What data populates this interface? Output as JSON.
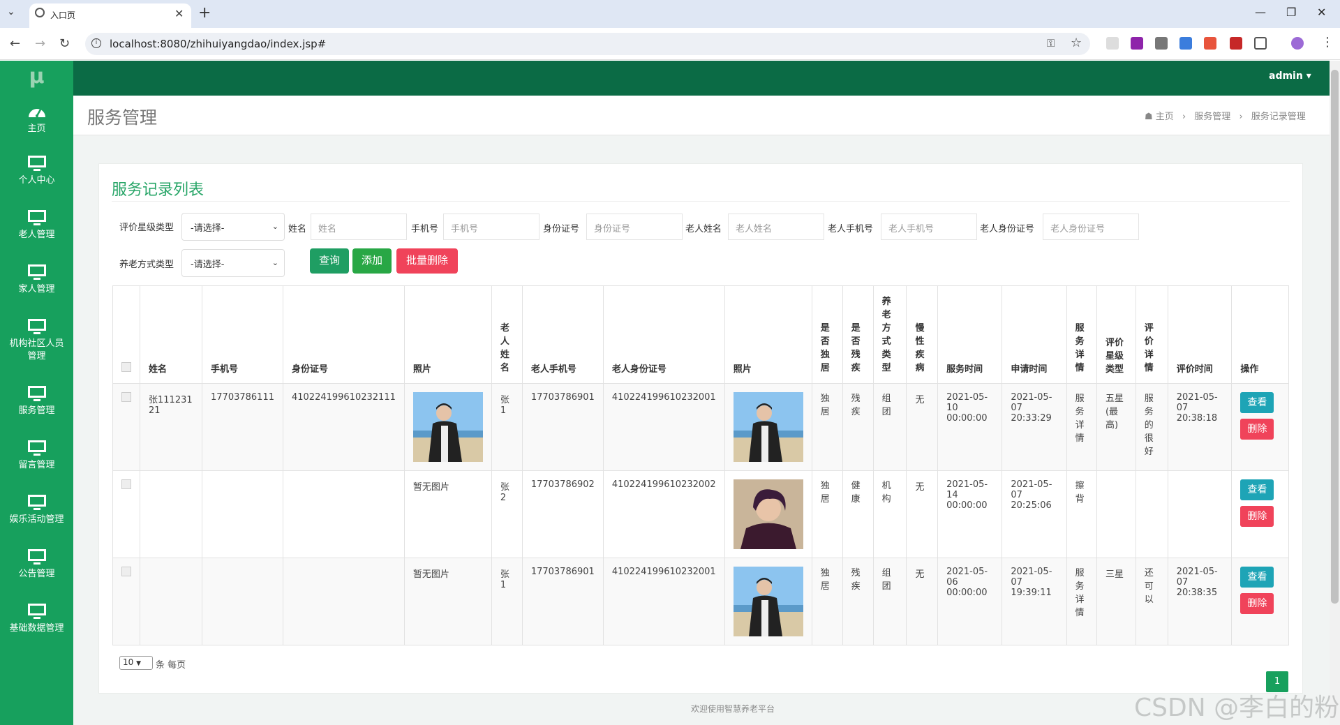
{
  "browser": {
    "tab_title": "入口页",
    "url": "localhost:8080/zhihuiyangdao/index.jsp#"
  },
  "sidebar": {
    "logo": "μ",
    "items": [
      {
        "label": "主页",
        "icon": "dashboard-icon"
      },
      {
        "label": "个人中心",
        "icon": "monitor-icon"
      },
      {
        "label": "老人管理",
        "icon": "monitor-icon"
      },
      {
        "label": "家人管理",
        "icon": "monitor-icon"
      },
      {
        "label": "机构社区人员管理",
        "icon": "monitor-icon"
      },
      {
        "label": "服务管理",
        "icon": "monitor-icon"
      },
      {
        "label": "留言管理",
        "icon": "monitor-icon"
      },
      {
        "label": "娱乐活动管理",
        "icon": "monitor-icon"
      },
      {
        "label": "公告管理",
        "icon": "monitor-icon"
      },
      {
        "label": "基础数据管理",
        "icon": "monitor-icon"
      }
    ]
  },
  "header": {
    "user": "admin ▾"
  },
  "page": {
    "title": "服务管理",
    "breadcrumb": [
      "主页",
      "服务管理",
      "服务记录管理"
    ],
    "card_title": "服务记录列表"
  },
  "search": {
    "rating_type_label": "评价星级类型",
    "rating_type_value": "-请选择-",
    "name_label": "姓名",
    "name_placeholder": "姓名",
    "phone_label": "手机号",
    "phone_placeholder": "手机号",
    "id_label": "身份证号",
    "id_placeholder": "身份证号",
    "elder_name_label": "老人姓名",
    "elder_name_placeholder": "老人姓名",
    "elder_phone_label": "老人手机号",
    "elder_phone_placeholder": "老人手机号",
    "elder_id_label": "老人身份证号",
    "elder_id_placeholder": "老人身份证号",
    "care_type_label": "养老方式类型",
    "care_type_value": "-请选择-",
    "query_btn": "查询",
    "add_btn": "添加",
    "batch_delete_btn": "批量删除"
  },
  "table": {
    "headers": [
      "姓名",
      "手机号",
      "身份证号",
      "照片",
      "老人姓名",
      "老人手机号",
      "老人身份证号",
      "照片",
      "是否独居",
      "是否残疾",
      "养老方式类型",
      "慢性疾病",
      "服务时间",
      "申请时间",
      "服务详情",
      "评价星级类型",
      "评价详情",
      "评价时间",
      "操作"
    ],
    "rows": [
      {
        "name": "张11123121",
        "phone": "17703786111",
        "id": "410224199610232111",
        "photo": "",
        "elder_name": "张1",
        "elder_phone": "17703786901",
        "elder_id": "410224199610232001",
        "alone": "独居",
        "disabled": "残疾",
        "care": "组团",
        "chronic": "无",
        "service_time": "2021-05-10 00:00:00",
        "apply_time": "2021-05-07 20:33:29",
        "detail": "服务详情",
        "rating": "五星(最高)",
        "review": "服务的很好",
        "review_time": "2021-05-07 20:38:18"
      },
      {
        "name": "",
        "phone": "",
        "id": "",
        "photo": "暂无图片",
        "elder_name": "张2",
        "elder_phone": "17703786902",
        "elder_id": "410224199610232002",
        "alone": "独居",
        "disabled": "健康",
        "care": "机构",
        "chronic": "无",
        "service_time": "2021-05-14 00:00:00",
        "apply_time": "2021-05-07 20:25:06",
        "detail": "擦背",
        "rating": "",
        "review": "",
        "review_time": ""
      },
      {
        "name": "",
        "phone": "",
        "id": "",
        "photo": "暂无图片",
        "elder_name": "张1",
        "elder_phone": "17703786901",
        "elder_id": "410224199610232001",
        "alone": "独居",
        "disabled": "残疾",
        "care": "组团",
        "chronic": "无",
        "service_time": "2021-05-06 00:00:00",
        "apply_time": "2021-05-07 19:39:11",
        "detail": "服务详情",
        "rating": "三星",
        "review": "还可以",
        "review_time": "2021-05-07 20:38:35"
      }
    ],
    "view_btn": "查看",
    "delete_btn": "删除"
  },
  "pager": {
    "page_size": "10",
    "per_page_label": "条 每页",
    "current_page": "1"
  },
  "footer": "欢迎使用智慧养老平台",
  "watermark": "CSDN @李白的粉",
  "colors": {
    "sidebar": "#17a05d",
    "topbar": "#0b6b45",
    "query": "#1f9e63",
    "add": "#28a745",
    "danger": "#f0435a",
    "view": "#1ea4b6"
  }
}
